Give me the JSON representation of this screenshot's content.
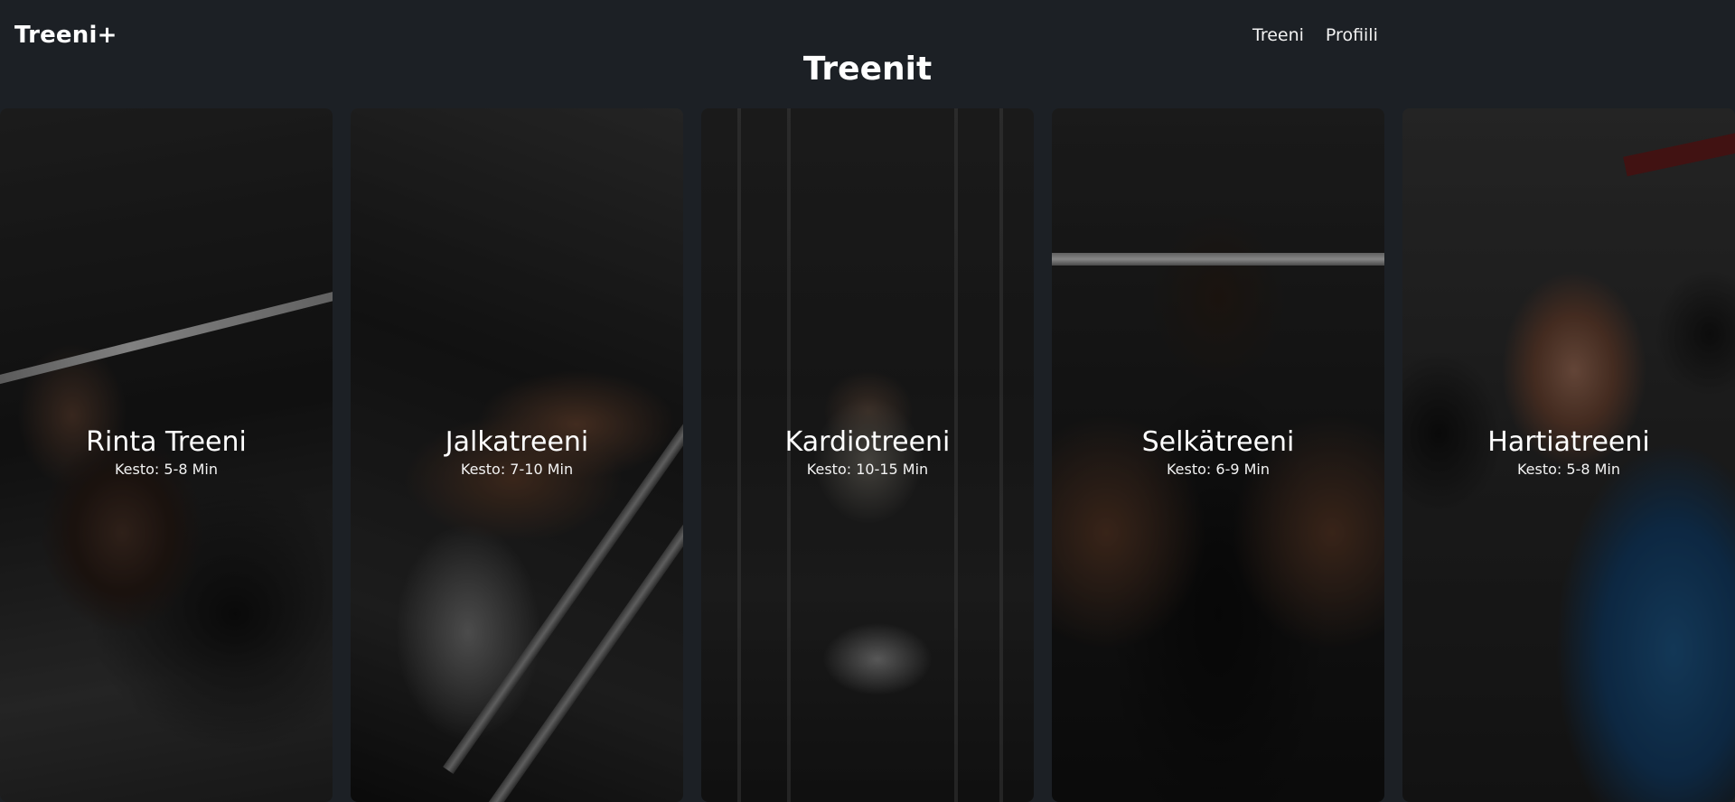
{
  "header": {
    "brand": "Treeni+",
    "nav": [
      {
        "label": "Treeni"
      },
      {
        "label": "Profiili"
      }
    ]
  },
  "page": {
    "title": "Treenit"
  },
  "workouts": [
    {
      "name": "Rinta Treeni",
      "duration": "Kesto: 5-8 Min"
    },
    {
      "name": "Jalkatreeni",
      "duration": "Kesto: 7-10 Min"
    },
    {
      "name": "Kardiotreeni",
      "duration": "Kesto: 10-15 Min"
    },
    {
      "name": "Selkätreeni",
      "duration": "Kesto: 6-9 Min"
    },
    {
      "name": "Hartiatreeni",
      "duration": "Kesto: 5-8 Min"
    }
  ]
}
